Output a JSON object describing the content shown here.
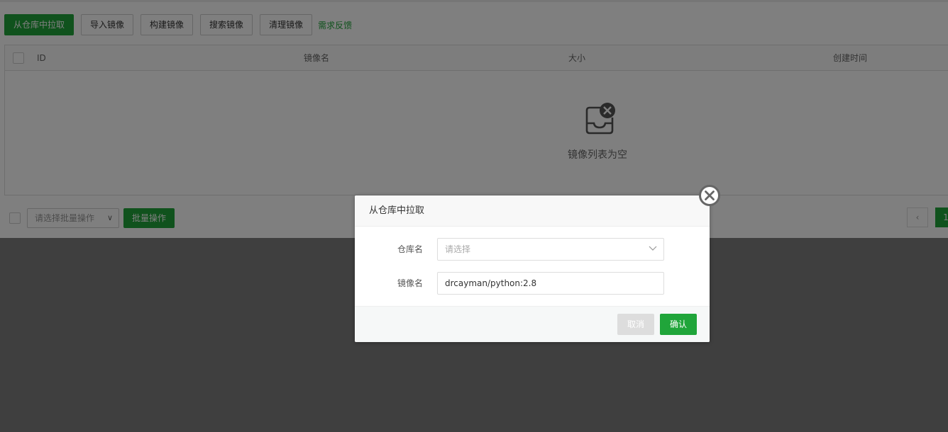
{
  "toolbar": {
    "pull_label": "从仓库中拉取",
    "import_label": "导入镜像",
    "build_label": "构建镜像",
    "search_label": "搜索镜像",
    "clean_label": "清理镜像",
    "feedback_label": "需求反馈"
  },
  "table": {
    "columns": [
      "ID",
      "镜像名",
      "大小",
      "创建时间"
    ],
    "empty_text": "镜像列表为空"
  },
  "batch": {
    "select_placeholder": "请选择批量操作",
    "button_label": "批量操作"
  },
  "pagination": {
    "prev_icon": "‹",
    "current_page": "1"
  },
  "modal": {
    "title": "从仓库中拉取",
    "registry_label": "仓库名",
    "registry_placeholder": "请选择",
    "image_label": "镜像名",
    "image_value": "drcayman/python:2.8",
    "cancel_label": "取消",
    "confirm_label": "确认"
  },
  "colors": {
    "primary": "#20a53a",
    "overlay": "rgba(0,0,0,0.5)"
  }
}
